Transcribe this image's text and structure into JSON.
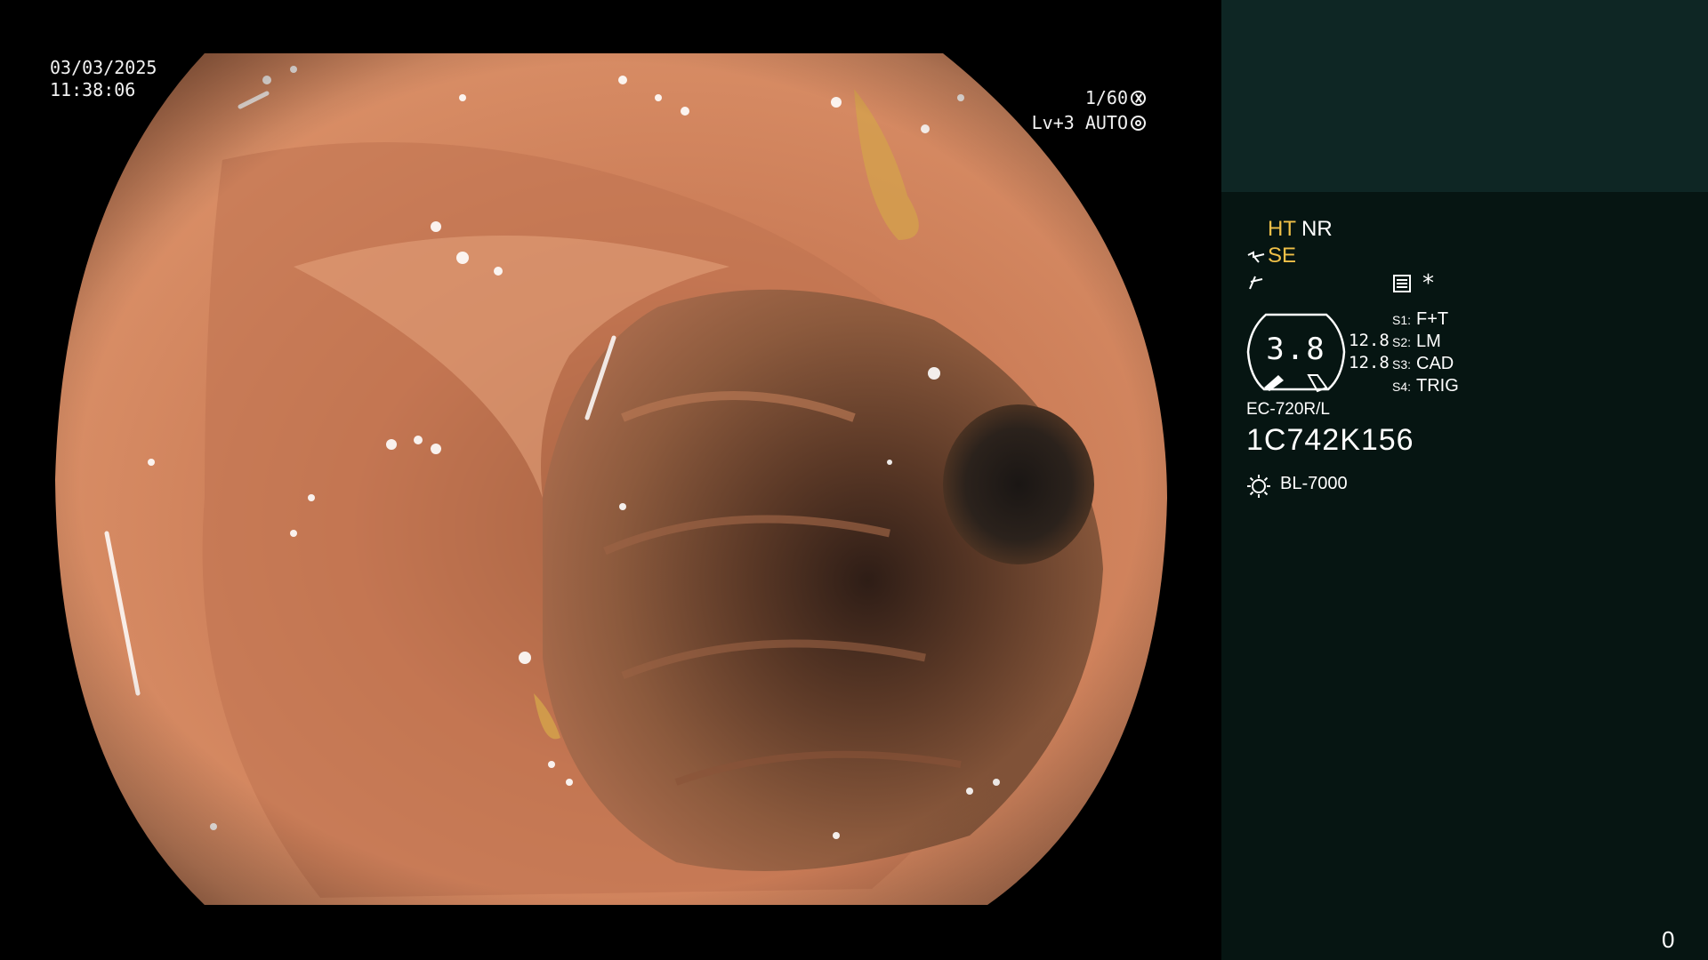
{
  "overlay": {
    "date": "03/03/2025",
    "time": "11:38:06",
    "shutter": "1/60",
    "level": "Lv+3 AUTO",
    "shutter_icon": "aperture-icon",
    "auto_icon": "auto-iris-icon"
  },
  "panel": {
    "modes": {
      "ht": "HT",
      "nr": "NR",
      "se": "SE"
    },
    "icons": {
      "wave": "wave-enhance-icon",
      "bolt": "bolt-icon",
      "memo": "memo-icon",
      "star": "*"
    },
    "gauge": {
      "value": "3.8",
      "upper": "12.8",
      "lower": "12.8"
    },
    "slots": [
      {
        "key": "S1:",
        "value": "F+T"
      },
      {
        "key": "S2:",
        "value": "LM"
      },
      {
        "key": "S3:",
        "value": "CAD"
      },
      {
        "key": "S4:",
        "value": "TRIG"
      }
    ],
    "scope_model": "EC-720R/L",
    "scope_serial": "1C742K156",
    "light_source": "BL-7000",
    "frame_count": "0"
  },
  "colors": {
    "accent_yellow": "#f0c048",
    "panel_bg": "#061512",
    "panel_top_bg": "#0e2624",
    "text": "#ffffff"
  }
}
